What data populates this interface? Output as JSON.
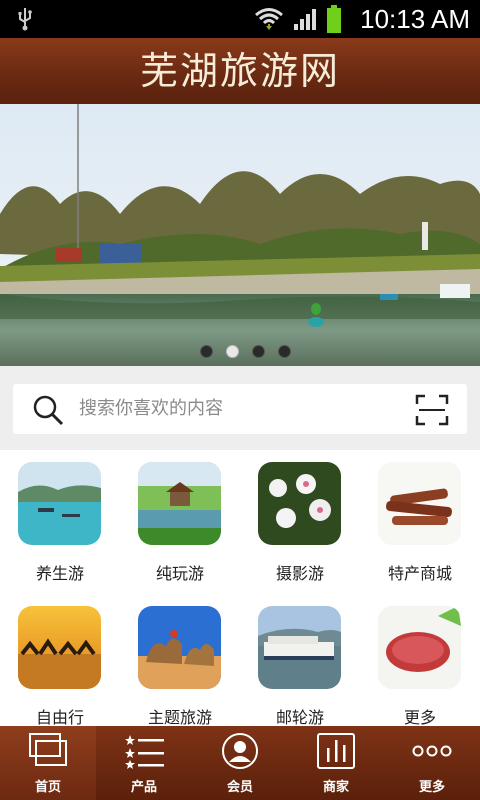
{
  "status_bar": {
    "time": "10:13 AM"
  },
  "header": {
    "title": "芜湖旅游网"
  },
  "banner": {
    "slide_count": 4,
    "active_slide": 2
  },
  "search": {
    "placeholder": "搜索你喜欢的内容"
  },
  "categories": [
    {
      "label": "养生游",
      "icon": "lake-boat-photo"
    },
    {
      "label": "纯玩游",
      "icon": "pavilion-photo"
    },
    {
      "label": "摄影游",
      "icon": "white-flowers-photo"
    },
    {
      "label": "特产商城",
      "icon": "dried-meat-photo"
    },
    {
      "label": "自由行",
      "icon": "camels-sunset-photo"
    },
    {
      "label": "主题旅游",
      "icon": "camel-desert-photo"
    },
    {
      "label": "邮轮游",
      "icon": "cruise-ship-photo"
    },
    {
      "label": "更多",
      "icon": "sliced-meat-photo"
    }
  ],
  "tabs": [
    {
      "label": "首页",
      "icon": "home-icon",
      "active": true
    },
    {
      "label": "产品",
      "icon": "star-list-icon"
    },
    {
      "label": "会员",
      "icon": "member-icon"
    },
    {
      "label": "商家",
      "icon": "shop-chart-icon"
    },
    {
      "label": "更多",
      "icon": "more-dots-icon"
    }
  ]
}
